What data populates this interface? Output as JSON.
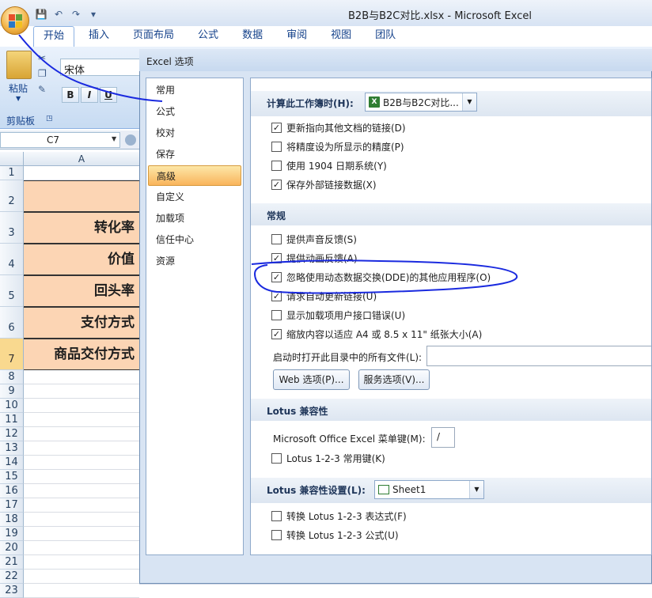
{
  "window": {
    "title": "B2B与B2C对比.xlsx - Microsoft Excel"
  },
  "qat": {
    "save": "💾",
    "undo": "↶",
    "redo": "↷",
    "more": "▾"
  },
  "ribbon": {
    "tabs": [
      "开始",
      "插入",
      "页面布局",
      "公式",
      "数据",
      "审阅",
      "视图",
      "团队"
    ],
    "active_tab": "开始",
    "paste_label": "粘贴",
    "clipboard_group": "剪贴板",
    "font_name": "宋体",
    "bold": "B",
    "italic": "I",
    "underline": "U"
  },
  "name_box": "C7",
  "sheet": {
    "column": "A",
    "rows": [
      {
        "n": "1",
        "text": ""
      },
      {
        "n": "2",
        "text": ""
      },
      {
        "n": "3",
        "text": "转化率"
      },
      {
        "n": "4",
        "text": "价值"
      },
      {
        "n": "5",
        "text": "回头率"
      },
      {
        "n": "6",
        "text": "支付方式"
      },
      {
        "n": "7",
        "text": "商品交付方式"
      },
      {
        "n": "8"
      },
      {
        "n": "9"
      },
      {
        "n": "10"
      },
      {
        "n": "11"
      },
      {
        "n": "12"
      },
      {
        "n": "13"
      },
      {
        "n": "14"
      },
      {
        "n": "15"
      },
      {
        "n": "16"
      },
      {
        "n": "17"
      },
      {
        "n": "18"
      },
      {
        "n": "19"
      },
      {
        "n": "20"
      },
      {
        "n": "21"
      },
      {
        "n": "22"
      },
      {
        "n": "23"
      }
    ]
  },
  "dialog": {
    "title": "Excel 选项",
    "nav": [
      "常用",
      "公式",
      "校对",
      "保存",
      "高级",
      "自定义",
      "加载项",
      "信任中心",
      "资源"
    ],
    "active_nav": "高级",
    "calc_section": {
      "label": "计算此工作簿时(H):",
      "workbook": "B2B与B2C对比...",
      "options": [
        {
          "label": "更新指向其他文档的链接(D)",
          "checked": true
        },
        {
          "label": "将精度设为所显示的精度(P)",
          "checked": false
        },
        {
          "label": "使用 1904 日期系统(Y)",
          "checked": false
        },
        {
          "label": "保存外部链接数据(X)",
          "checked": true
        }
      ]
    },
    "general_section": {
      "label": "常规",
      "options": [
        {
          "label": "提供声音反馈(S)",
          "checked": false
        },
        {
          "label": "提供动画反馈(A)",
          "checked": true
        },
        {
          "label": "忽略使用动态数据交换(DDE)的其他应用程序(O)",
          "checked": true
        },
        {
          "label": "请求自动更新链接(U)",
          "checked": true
        },
        {
          "label": "显示加载项用户接口错误(U)",
          "checked": false
        },
        {
          "label": "缩放内容以适应 A4 或 8.5 x 11\" 纸张大小(A)",
          "checked": true
        }
      ],
      "startup_label": "启动时打开此目录中的所有文件(L):",
      "startup_value": "",
      "web_button": "Web 选项(P)...",
      "service_button": "服务选项(V)..."
    },
    "lotus_section": {
      "label": "Lotus 兼容性",
      "menu_key_label": "Microsoft Office Excel 菜单键(M):",
      "menu_key_value": "/",
      "options": [
        {
          "label": "Lotus 1-2-3 常用键(K)",
          "checked": false
        }
      ]
    },
    "lotus_settings_section": {
      "label": "Lotus 兼容性设置(L):",
      "sheet": "Sheet1",
      "options": [
        {
          "label": "转换 Lotus 1-2-3 表达式(F)",
          "checked": false
        },
        {
          "label": "转换 Lotus 1-2-3 公式(U)",
          "checked": false
        }
      ]
    }
  },
  "colors": {
    "accent": "#f9b45b",
    "cell_fill": "#fcd5b4",
    "annotation": "#1a2adf"
  }
}
